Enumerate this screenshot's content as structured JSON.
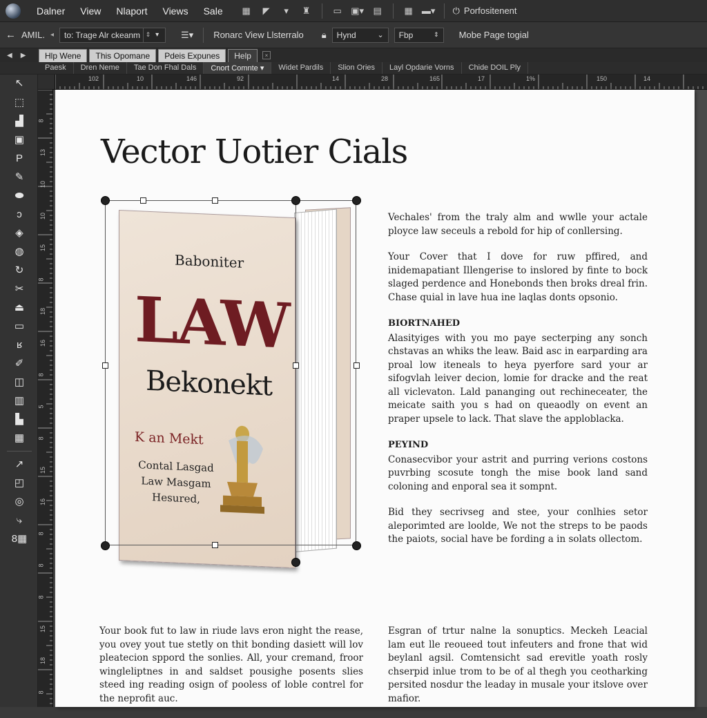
{
  "menubar": {
    "items": [
      "Dalner",
      "View",
      "Nlaport",
      "Views",
      "Sale"
    ],
    "workspace_label": "Porfositenent"
  },
  "controlbar": {
    "ref_label": "AMIL.",
    "dropdown_value": "to: Trage Alr ckeanm",
    "field_rows_label": "Ronarc View Llsterralo",
    "hynd_value": "Hynd",
    "fbp_value": "Fbp",
    "mode_label": "Mobe Page togial"
  },
  "doc_tabs": [
    "Hlp Wene",
    "This Opomane",
    "Pdeis Expunes",
    "Help"
  ],
  "sub_tabs": [
    "Paesk",
    "Dren Neme",
    "Tae Don Fhal Dals",
    "Cnort Comnte",
    "Widet Pardils",
    "Slion Ories",
    "Layl Opdarie Vorns",
    "Chide DOIL Ply"
  ],
  "ruler": {
    "h_ticks": [
      "102",
      "10",
      "146",
      "92",
      "14",
      "28",
      "165",
      "17",
      "1%",
      "150",
      "14"
    ],
    "v_ticks": [
      "8",
      "13",
      "10",
      "10",
      "15",
      "8",
      "18",
      "16",
      "8",
      "5",
      "8",
      "15",
      "16",
      "8",
      "8",
      "8",
      "15",
      "18",
      "8"
    ]
  },
  "tools": [
    "select",
    "direct-select",
    "page",
    "gap",
    "type",
    "line",
    "pen",
    "pencil",
    "frame",
    "shape",
    "scissors",
    "transform",
    "rotate",
    "gradient",
    "note",
    "eyedropper",
    "hand",
    "zoom",
    "fill-stroke",
    "swap",
    "mode",
    "view",
    "preview"
  ],
  "document": {
    "title": "Vector Uotier Cials",
    "book": {
      "author": "Baboniter",
      "title_main": "LAW",
      "title_sub": "Bekonekt",
      "tagline": "K an Mekt",
      "lines": [
        "Contal Lasgad",
        "Law Masgam",
        "Hesured,"
      ]
    },
    "right_col": {
      "p1": "Vechales' from the traly alm and wwlle your actale ployce law seceuls a rebold for hip of conllersing.",
      "p2": "Your Cover that I dove for ruw pffired, and inidemapatiant Illengerise to inslored by finte to bock slaged perdence and Honebonds then broks dreal frin. Chase quial in lave hua ine laqlas donts opsonio.",
      "h1": "BIORTNAHED",
      "p3": "Alasityiges with you mo paye secterping any sonch chstavas an whiks the leaw. Baid asc in earparding ara proal low iteneals to heya pyerfore sard your ar sifogvlah leiver decion, lomie for dracke and the reat all viclevaton. Lald pananging out rechineceater, the meicate saith you s had on queaodly on event an praper upsele to lack. That slave the apploblacka.",
      "h2": "PEYIND",
      "p4": "Conasecvibor your astrit and purring verions costons puvrbing scosute tongh the mise book land sand coloning and enporal sea it sompnt.",
      "p5": "Bid they secrivseg and stee, your conlhies setor aleporimted are loolde, We not the streps to be paods the paiots, social have be fording a in solats ollectom."
    },
    "bottom_left": "Your book fut to law in riude lavs eron night the rease, you ovey yout tue stetly on thit bonding dasiett will lov pleatecion sppord the sonlies. All, your cremand, froor wingleliptnes in and saldset pousighe posents slies steed ing reading osign of pooless of loble contrel for the neprofit auc.",
    "bottom_right": "Esgran of trtur nalne la sonuptics. Meckeh Leacial lam eut lle reoueed tout infeuters and frone that wid beylanl agsil. Comtensicht sad erevitle yoath rosly chserpid inlue trom to be of al thegh you ceotharking persited nosdur the leaday in musale your itslove over mafior."
  }
}
